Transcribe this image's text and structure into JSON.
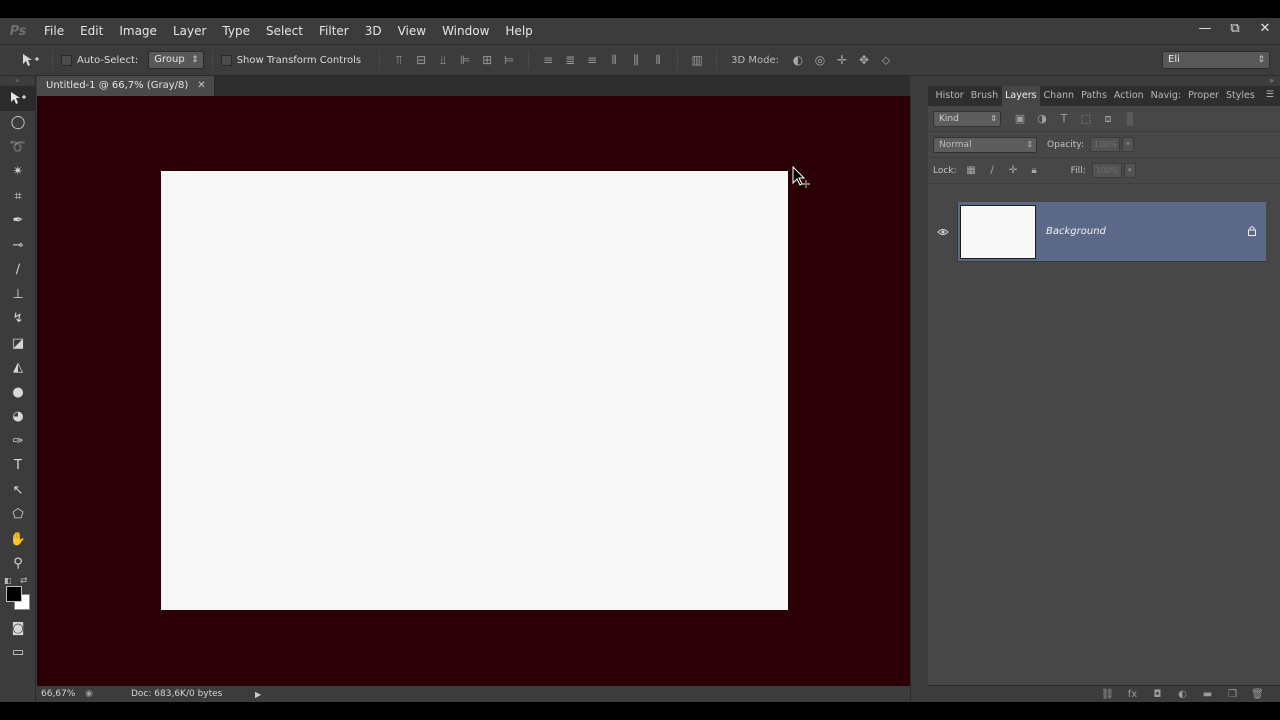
{
  "app": {
    "logo": "Ps"
  },
  "menu": [
    "File",
    "Edit",
    "Image",
    "Layer",
    "Type",
    "Select",
    "Filter",
    "3D",
    "View",
    "Window",
    "Help"
  ],
  "window_controls": {
    "minimize": "—",
    "restore": "⧉",
    "close": "✕"
  },
  "options": {
    "auto_select_label": "Auto-Select:",
    "auto_select_value": "Group",
    "transform_label": "Show Transform Controls",
    "mode_3d_label": "3D Mode:",
    "workspace_value": "Eli"
  },
  "document": {
    "tab_title": "Untitled-1 @ 66,7% (Gray/8)",
    "tab_close": "✕",
    "canvas_bg": "#2c0007",
    "canvas_fill": "#f8f8f8"
  },
  "status": {
    "zoom": "66,67%",
    "doc_info": "Doc: 683,6K/0 bytes"
  },
  "panel": {
    "tabs": [
      "Histor",
      "Brush",
      "Layers",
      "Chann",
      "Paths",
      "Action",
      "Navig:",
      "Proper",
      "Styles"
    ],
    "active_tab": "Layers",
    "kind_label": "Kind",
    "blend_mode": "Normal",
    "opacity_label": "Opacity:",
    "opacity_value": "100%",
    "lock_label": "Lock:",
    "fill_label": "Fill:",
    "fill_value": "100%",
    "selection_color": "#5c6888"
  },
  "layers": [
    {
      "name": "Background",
      "visible": true,
      "locked": true
    }
  ],
  "icons": {
    "move": "move-icon",
    "eye": "eye-icon",
    "lock": "lock-icon"
  }
}
